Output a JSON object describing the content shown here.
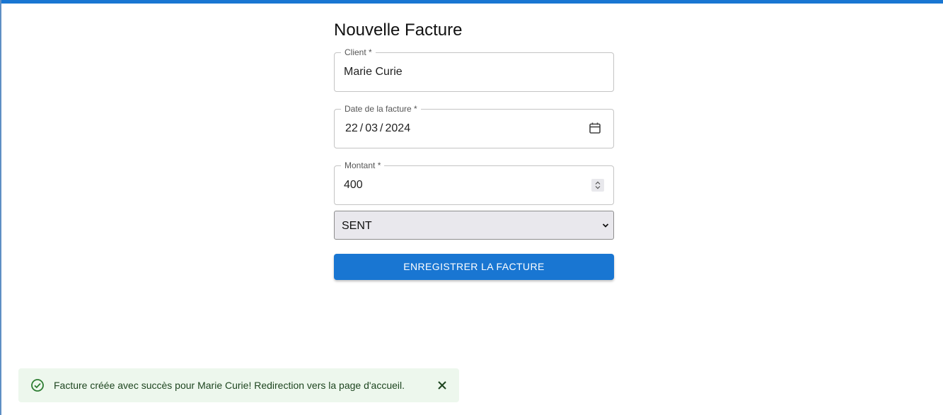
{
  "page": {
    "title": "Nouvelle Facture"
  },
  "form": {
    "client": {
      "label": "Client *",
      "value": "Marie Curie"
    },
    "date": {
      "label": "Date de la facture *",
      "day": "22",
      "month": "03",
      "year": "2024",
      "separator": "/",
      "icon": "calendar-icon"
    },
    "amount": {
      "label": "Montant *",
      "value": "400",
      "icon": "spinner-icon"
    },
    "status": {
      "selected": "SENT",
      "icon": "chevron-down-icon"
    },
    "submit_label": "ENREGISTRER LA FACTURE"
  },
  "notification": {
    "icon": "check-circle-icon",
    "message": "Facture créée avec succès pour Marie Curie! Redirection vers la page d'accueil.",
    "close_icon": "close-icon"
  },
  "colors": {
    "primary": "#1976d2",
    "success_bg": "#edf7ed",
    "success_icon": "#2e7d32",
    "success_text": "#1e4620",
    "select_bg": "#e9e8ed"
  }
}
